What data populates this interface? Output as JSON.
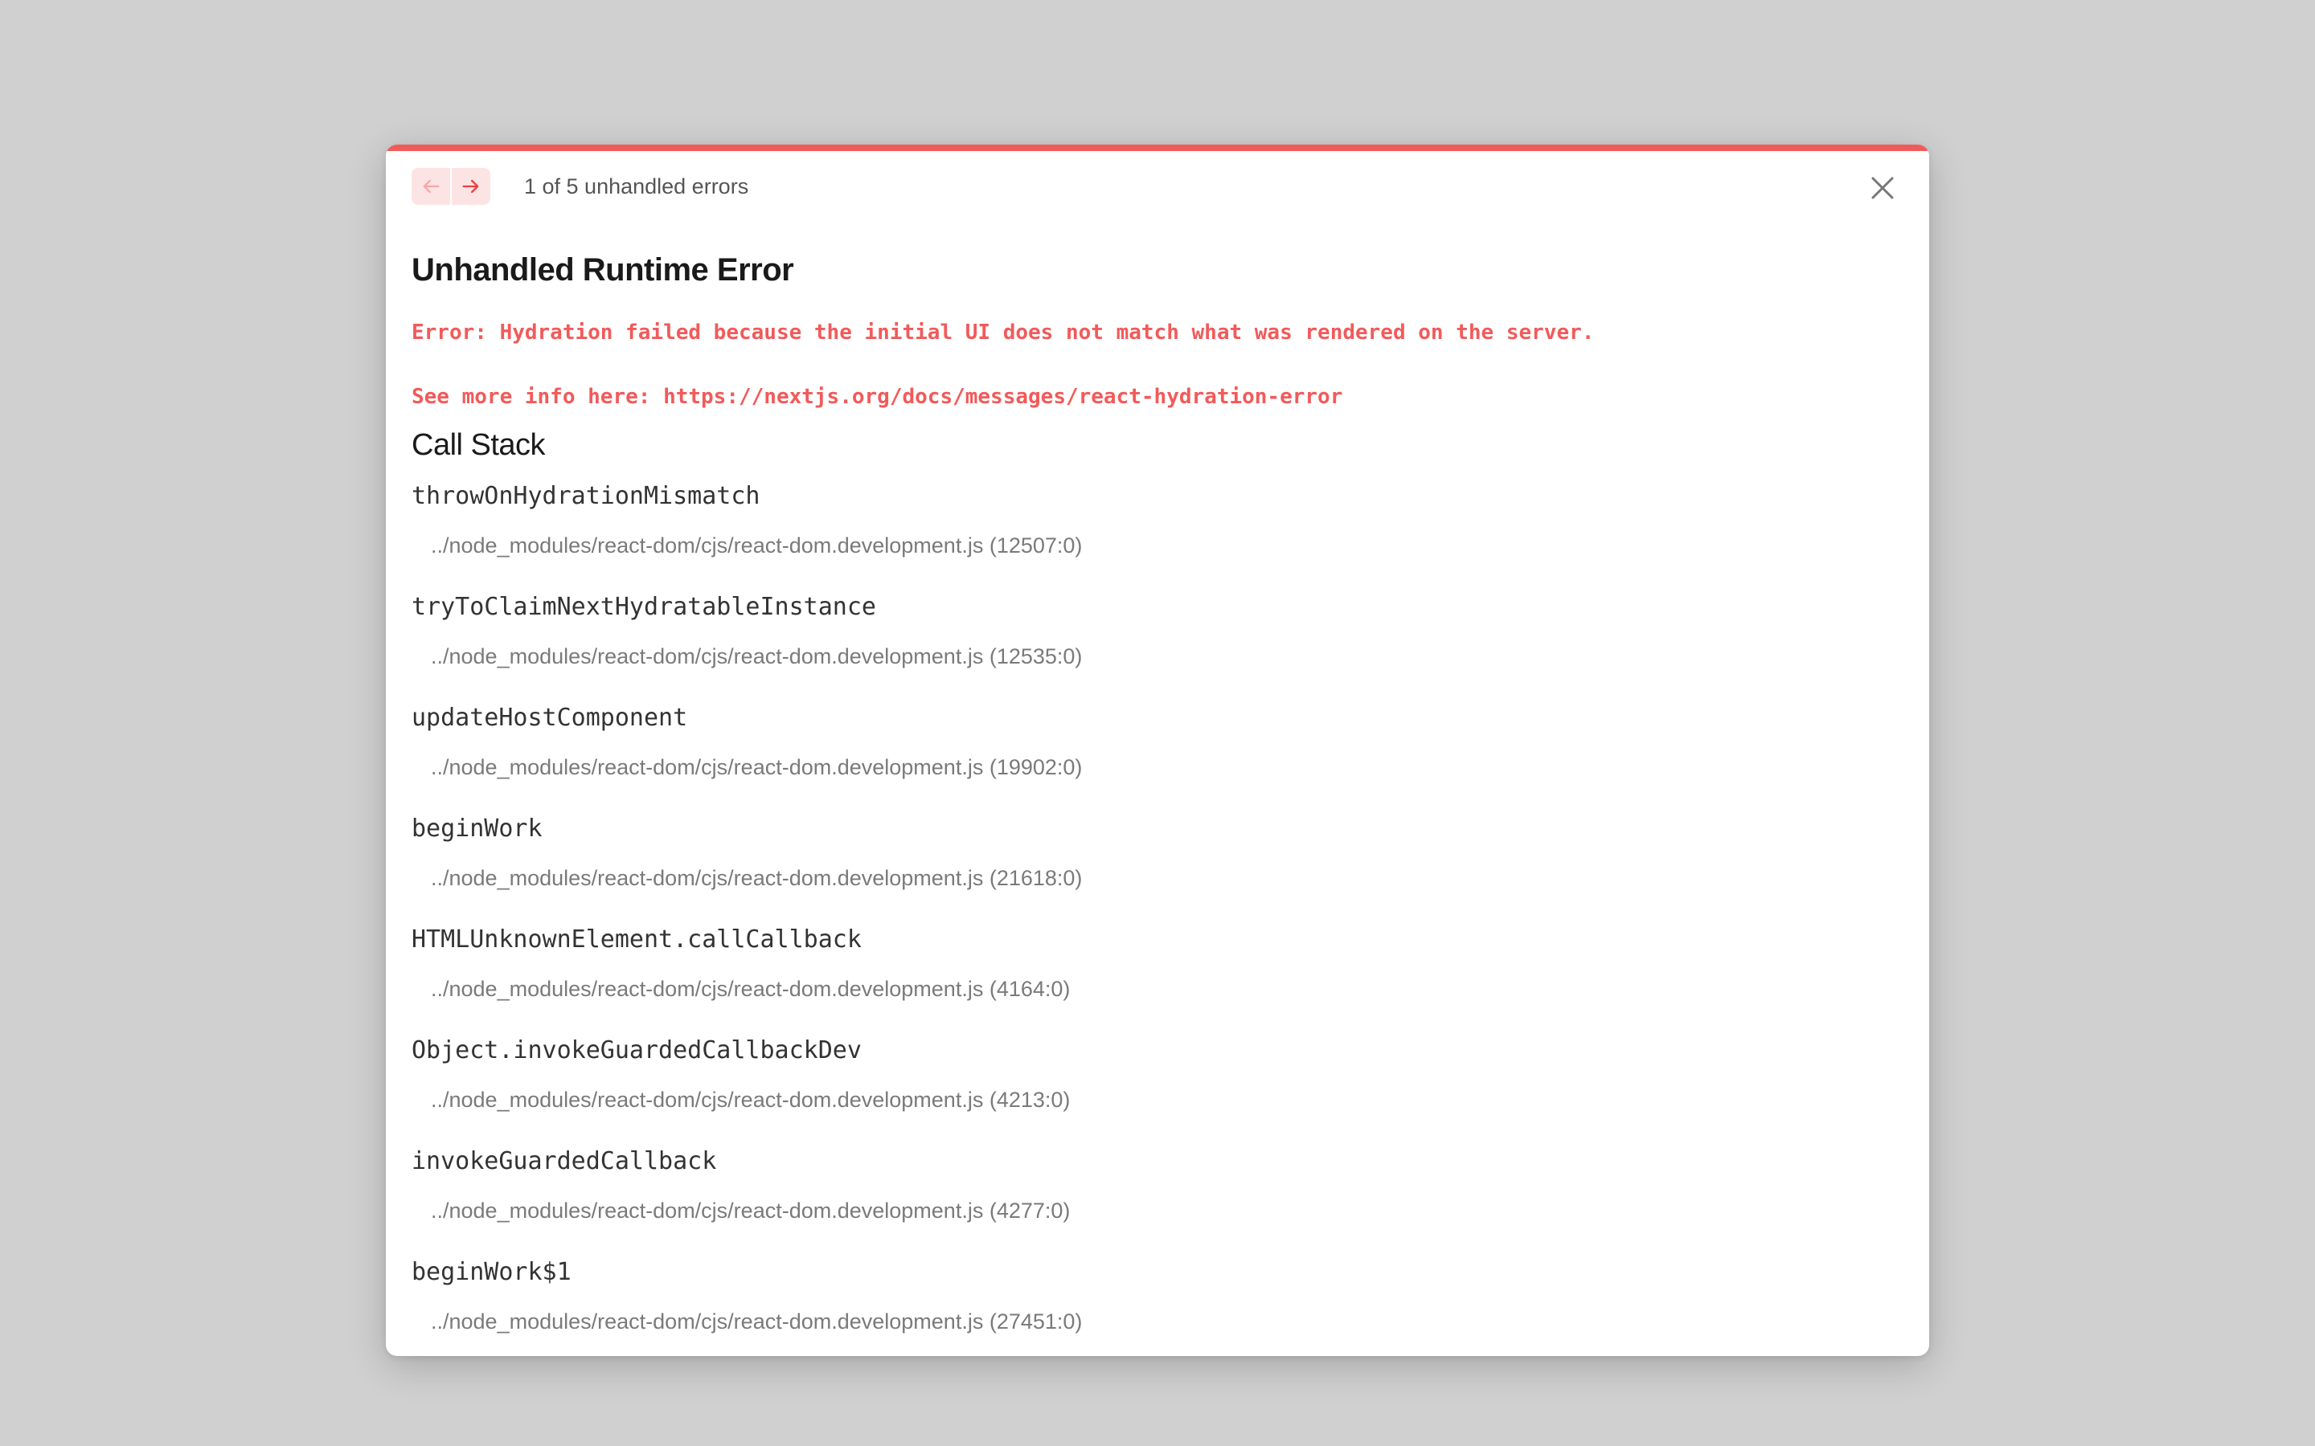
{
  "nav": {
    "prev_icon": "arrow-left-icon",
    "next_icon": "arrow-right-icon",
    "counter_label": "1 of 5 unhandled errors",
    "close_icon": "close-icon"
  },
  "error": {
    "title": "Unhandled Runtime Error",
    "message": "Error: Hydration failed because the initial UI does not match what was rendered on the server.",
    "info": "See more info here: https://nextjs.org/docs/messages/react-hydration-error"
  },
  "call_stack": {
    "heading": "Call Stack",
    "frames": [
      {
        "fn": "throwOnHydrationMismatch",
        "loc": "../node_modules/react-dom/cjs/react-dom.development.js (12507:0)"
      },
      {
        "fn": "tryToClaimNextHydratableInstance",
        "loc": "../node_modules/react-dom/cjs/react-dom.development.js (12535:0)"
      },
      {
        "fn": "updateHostComponent",
        "loc": "../node_modules/react-dom/cjs/react-dom.development.js (19902:0)"
      },
      {
        "fn": "beginWork",
        "loc": "../node_modules/react-dom/cjs/react-dom.development.js (21618:0)"
      },
      {
        "fn": "HTMLUnknownElement.callCallback",
        "loc": "../node_modules/react-dom/cjs/react-dom.development.js (4164:0)"
      },
      {
        "fn": "Object.invokeGuardedCallbackDev",
        "loc": "../node_modules/react-dom/cjs/react-dom.development.js (4213:0)"
      },
      {
        "fn": "invokeGuardedCallback",
        "loc": "../node_modules/react-dom/cjs/react-dom.development.js (4277:0)"
      },
      {
        "fn": "beginWork$1",
        "loc": "../node_modules/react-dom/cjs/react-dom.development.js (27451:0)"
      }
    ]
  },
  "colors": {
    "accent": "#f25a5a",
    "backdrop": "#d0d0d0",
    "nav_button_bg": "#fde4e4"
  }
}
